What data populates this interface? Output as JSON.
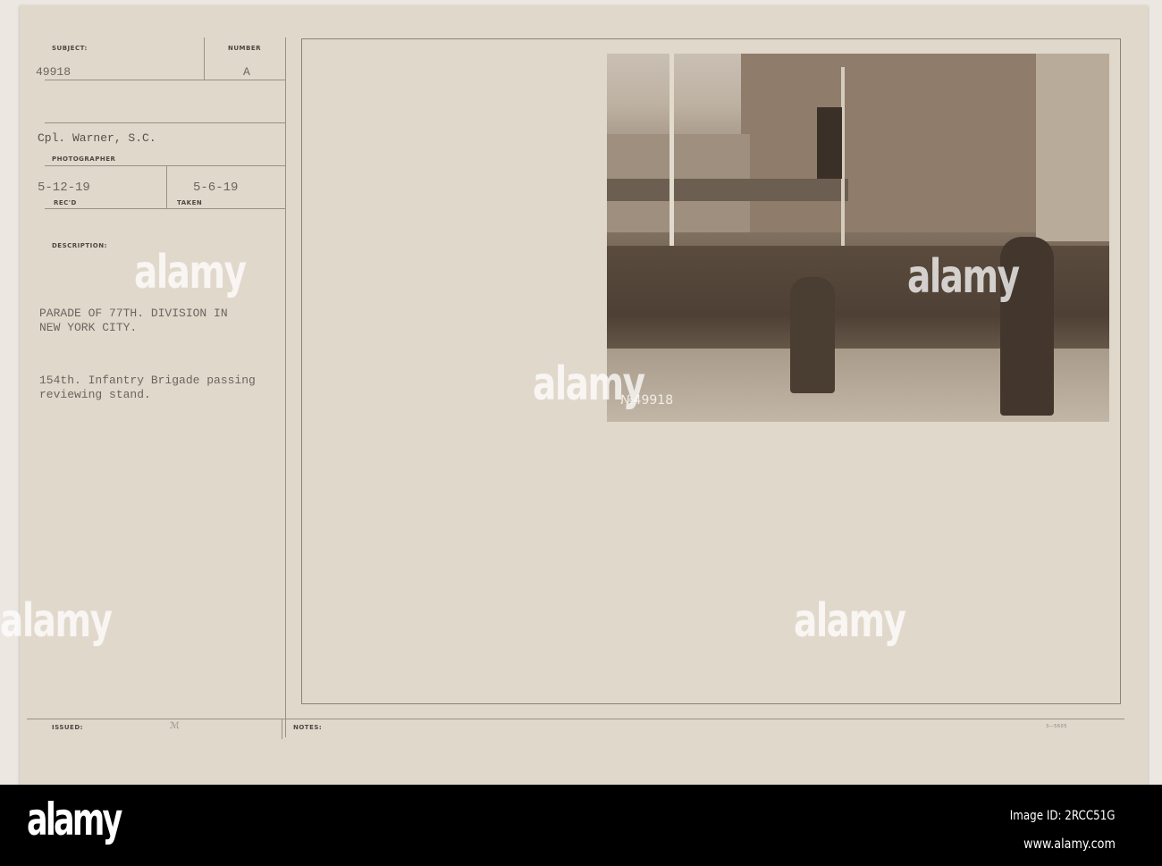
{
  "card": {
    "subject_label": "SUBJECT:",
    "subject_value": "49918",
    "number_label": "NUMBER",
    "number_value": "A",
    "photographer_value": "Cpl. Warner, S.C.",
    "photographer_label": "PHOTOGRAPHER",
    "recd_value": "5-12-19",
    "recd_label": "REC'D",
    "taken_value": "5-6-19",
    "taken_label": "TAKEN",
    "description_label": "DESCRIPTION:",
    "description_line1": "PARADE OF 77TH. DIVISION IN",
    "description_line2": "NEW YORK CITY.",
    "description_line3": "154th. Infantry Brigade passing",
    "description_line4": "reviewing stand.",
    "issued_label": "ISSUED:",
    "issued_mark": "ℳ",
    "notes_label": "NOTES:",
    "form_number": "3—5605"
  },
  "photo": {
    "negative_number": "№49918",
    "description": "Soldiers marching past reviewing stand"
  },
  "watermark": {
    "text": "alamy",
    "small": "a"
  },
  "footer": {
    "brand": "alamy",
    "image_id": "Image ID: 2RCC51G",
    "url": "www.alamy.com"
  }
}
